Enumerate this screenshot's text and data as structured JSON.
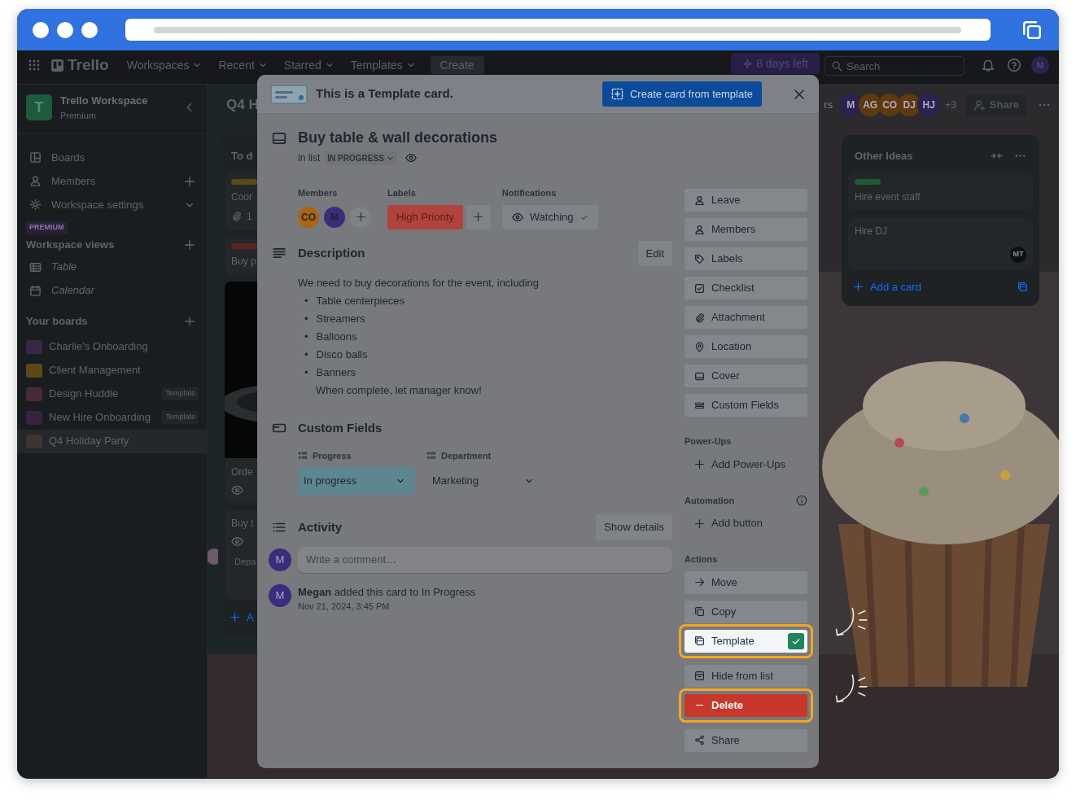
{
  "nav": {
    "logo": "Trello",
    "menus": [
      {
        "label": "Workspaces"
      },
      {
        "label": "Recent"
      },
      {
        "label": "Starred"
      },
      {
        "label": "Templates"
      }
    ],
    "create": "Create",
    "trial": "8 days left",
    "search": {
      "placeholder": "Search"
    },
    "avatar": "M"
  },
  "sidebar": {
    "workspace": {
      "initial": "T",
      "name": "Trello Workspace",
      "plan": "Premium"
    },
    "items": [
      {
        "label": "Boards",
        "kind": "link"
      },
      {
        "label": "Members",
        "kind": "add"
      },
      {
        "label": "Workspace settings",
        "kind": "expand"
      }
    ],
    "premium_badge": "PREMIUM",
    "views_heading": "Workspace views",
    "views": [
      {
        "label": "Table"
      },
      {
        "label": "Calendar"
      }
    ],
    "boards_heading": "Your boards",
    "boards": [
      {
        "name": "Charlie's Onboarding",
        "color": "#3a2747",
        "selected": false
      },
      {
        "name": "Client Management",
        "color": "#5a4a16",
        "selected": false
      },
      {
        "name": "Design Huddle",
        "color": "#4a2a36",
        "tag": "Template",
        "selected": false
      },
      {
        "name": "New Hire Onboarding",
        "color": "#36243f",
        "tag": "Template",
        "selected": false
      },
      {
        "name": "Q4 Holiday Party",
        "color": "#3e3430",
        "selected": true
      }
    ]
  },
  "board": {
    "title": "Q4 H",
    "filter_fragment": "rs",
    "members": [
      {
        "initials": "M",
        "color": "#2a2250"
      },
      {
        "initials": "AG",
        "color": "#5e3a0e"
      },
      {
        "initials": "CO",
        "color": "#5e3a0e"
      },
      {
        "initials": "DJ",
        "color": "#5e3a0e"
      },
      {
        "initials": "HJ",
        "color": "#2a2250"
      }
    ],
    "more_members": "+3",
    "share": "Share",
    "lists": [
      {
        "title": "To d",
        "cards": [
          {
            "color": "#5a4c14",
            "title": "Coor",
            "attachments": "1",
            "watching": false
          },
          {
            "color": "#5c2420",
            "title": "Buy p",
            "watching": false
          },
          {
            "kind": "cover",
            "title": "Orde",
            "watching": true
          },
          {
            "title": "Buy t",
            "field": "Depa",
            "watching": true
          }
        ],
        "add": "A"
      },
      {
        "title": "Other Ideas",
        "cards": [
          {
            "color": "#1d5a38",
            "title": "Hire event staff",
            "watching": false
          },
          {
            "title": "Hire DJ",
            "member": "MT",
            "watching": false
          }
        ],
        "add": "Add a card"
      }
    ]
  },
  "modal": {
    "banner": {
      "text": "This is a Template card.",
      "button": "Create card from template"
    },
    "card": {
      "title": "Buy table & wall decorations",
      "list_prefix": "in list",
      "list_name": "IN PROGRESS",
      "watching": true
    },
    "members": {
      "heading": "Members",
      "avatars": [
        {
          "initials": "CO",
          "color": "#a9660e"
        },
        {
          "initials": "M",
          "color": "#3b2d7c"
        }
      ]
    },
    "labels": {
      "heading": "Labels",
      "items": [
        {
          "name": "High Priority",
          "color": "#b0443c"
        }
      ]
    },
    "notifications": {
      "heading": "Notifications",
      "value": "Watching"
    },
    "description": {
      "heading": "Description",
      "edit": "Edit",
      "intro": "We need to buy decorations for the event, including",
      "marker": "•",
      "bullets": [
        "Table centerpieces",
        "Streamers",
        "Balloons",
        "Disco balls",
        "Banners"
      ],
      "note": "When complete, let manager know!"
    },
    "custom_fields": {
      "heading": "Custom Fields",
      "fields": [
        {
          "label": "Progress",
          "value": "In progress",
          "color": "#5e8690"
        },
        {
          "label": "Department",
          "value": "Marketing"
        }
      ]
    },
    "activity": {
      "heading": "Activity",
      "button": "Show details",
      "avatar": "M",
      "comment_placeholder": "Write a comment…",
      "entries": [
        {
          "avatar": "M",
          "text": "**Megan** added this card to In Progress",
          "time": "Nov 21, 2024, 3:45 PM"
        }
      ]
    },
    "add_to_card": [
      {
        "label": "Leave"
      },
      {
        "label": "Members"
      },
      {
        "label": "Labels"
      },
      {
        "label": "Checklist"
      },
      {
        "label": "Attachment"
      },
      {
        "label": "Location"
      },
      {
        "label": "Cover"
      },
      {
        "label": "Custom Fields"
      }
    ],
    "sections": [
      {
        "heading": "Power-Ups",
        "info": false,
        "items": [
          {
            "label": "Add Power-Ups",
            "kind": "add",
            "highlighted": false
          }
        ]
      },
      {
        "heading": "Automation",
        "info": true,
        "items": [
          {
            "label": "Add button",
            "kind": "add",
            "highlighted": false
          }
        ]
      },
      {
        "heading": "Actions",
        "info": false,
        "items": [
          {
            "label": "Move",
            "kind": "plain",
            "highlighted": false
          },
          {
            "label": "Copy",
            "kind": "plain",
            "highlighted": false
          },
          {
            "label": "Template",
            "kind": "toggle",
            "checked": true,
            "highlighted": true
          },
          {
            "label": "Hide from list",
            "kind": "plain",
            "highlighted": false
          },
          {
            "label": "Delete",
            "kind": "danger",
            "highlighted": true
          },
          {
            "label": "Share",
            "kind": "plain",
            "highlighted": false
          }
        ]
      }
    ]
  }
}
